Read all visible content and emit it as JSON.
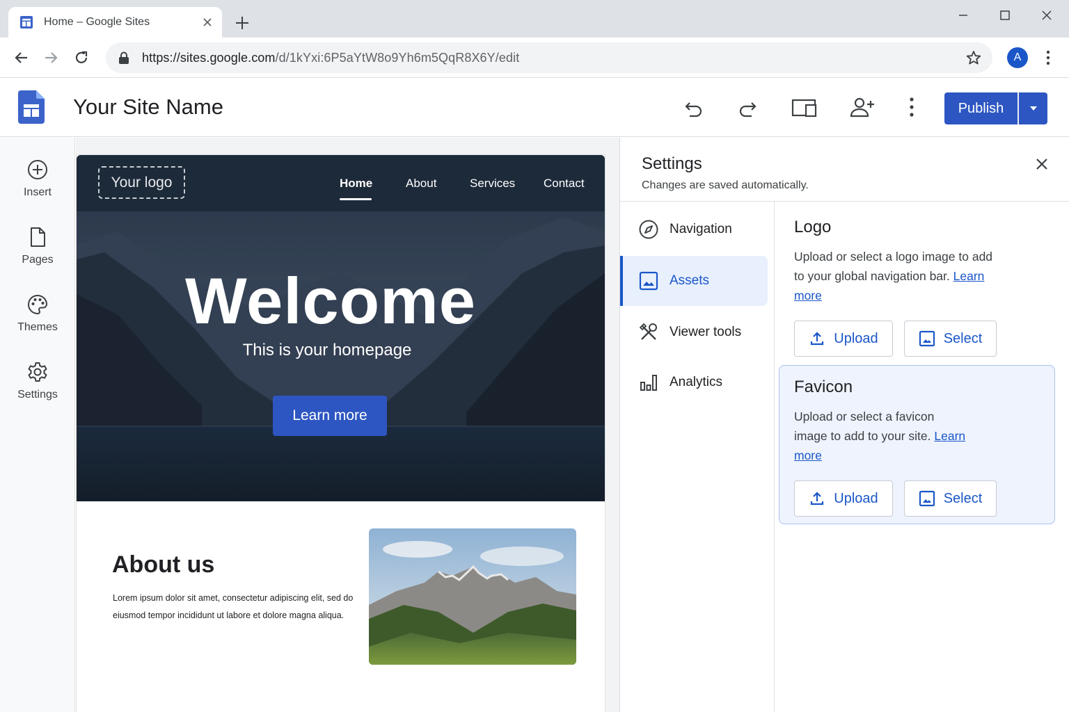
{
  "browser": {
    "tab_title": "Home – Google Sites",
    "url_host": "https://sites.google.com",
    "url_path": "/d/1kYxi:6P5aYtW8o9Yh6m5QqR8X6Y/edit",
    "avatar_letter": "A"
  },
  "app": {
    "site_name": "Your Site Name",
    "publish_label": "Publish"
  },
  "rail": {
    "items": [
      {
        "label": "Insert",
        "icon": "plus-circle-icon"
      },
      {
        "label": "Pages",
        "icon": "page-icon"
      },
      {
        "label": "Themes",
        "icon": "palette-icon"
      },
      {
        "label": "Settings",
        "icon": "gear-icon"
      }
    ]
  },
  "site": {
    "logo_placeholder": "Your logo",
    "nav": [
      "Home",
      "About",
      "Services",
      "Contact"
    ],
    "active_nav": "Home",
    "hero_title": "Welcome",
    "hero_subtitle": "This is your homepage",
    "hero_button": "Learn more",
    "about_title": "About us",
    "about_text": "Lorem ipsum dolor sit amet, consectetur adipiscing elit, sed do eiusmod tempor incididunt ut labore et dolore magna aliqua."
  },
  "settings": {
    "title": "Settings",
    "subtitle": "Changes are saved automatically.",
    "nav": [
      {
        "label": "Navigation",
        "icon": "compass-icon"
      },
      {
        "label": "Assets",
        "icon": "image-icon"
      },
      {
        "label": "Viewer tools",
        "icon": "tools-icon"
      },
      {
        "label": "Analytics",
        "icon": "bar-chart-icon"
      }
    ],
    "active_nav": "Assets",
    "logo": {
      "title": "Logo",
      "desc": "Upload or select a logo image to add to your global navigation bar.",
      "link": "Learn more",
      "upload": "Upload",
      "select": "Select"
    },
    "favicon": {
      "title": "Favicon",
      "desc": "Upload or select a favicon image to add to your site.",
      "link": "Learn more",
      "upload": "Upload",
      "select": "Select"
    }
  },
  "colors": {
    "accent": "#2d56c2",
    "link": "#1a56c8",
    "hero_nav_bg": "#1d2a3a",
    "active_bg": "#e8f0fe"
  }
}
